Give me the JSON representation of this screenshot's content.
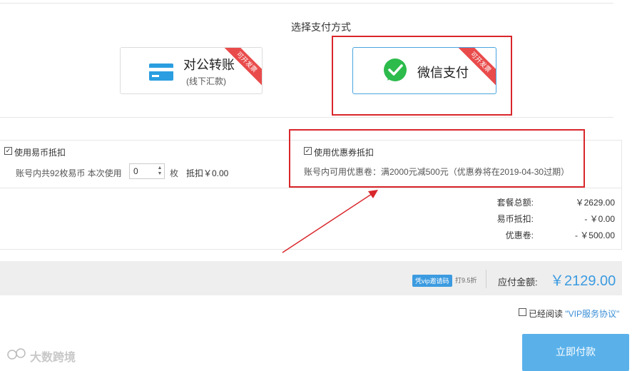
{
  "header": {
    "title": "选择支付方式"
  },
  "payment_methods": [
    {
      "main": "对公转账",
      "sub": "(线下汇款)",
      "ribbon": "可开发票",
      "icon": "card-icon",
      "selected": false
    },
    {
      "main": "微信支付",
      "ribbon": "可开发票",
      "icon": "wechat-icon",
      "selected": true
    }
  ],
  "coins": {
    "checkbox_label": "使用易币抵扣",
    "account_text": "账号内共92枚易币 本次使用",
    "quantity": "0",
    "unit": "枚",
    "deduct_text": "抵扣￥0.00"
  },
  "coupon": {
    "checkbox_label": "使用优惠券抵扣",
    "detail": "账号内可用优惠卷：满2000元减500元（优惠券将在2019-04-30过期）"
  },
  "summary": [
    {
      "label": "套餐总额:",
      "value": "￥2629.00"
    },
    {
      "label": "易币抵扣:",
      "value": "- ￥0.00"
    },
    {
      "label": "优惠卷:",
      "value": "- ￥500.00"
    }
  ],
  "paybar": {
    "vip_badge": "凭vip邀请码",
    "discount": "打9.5折",
    "amount_label": "应付金额:",
    "amount": "￥2129.00"
  },
  "agreement": {
    "prefix": "已经阅读",
    "link": "\"VIP服务协议\""
  },
  "submit_label": "立即付款",
  "watermark": "大数跨境",
  "colors": {
    "accent": "#5ab1ea",
    "highlight": "#d9262b",
    "wechat": "#2dbb4c",
    "ribbon": "#e94b4b"
  }
}
